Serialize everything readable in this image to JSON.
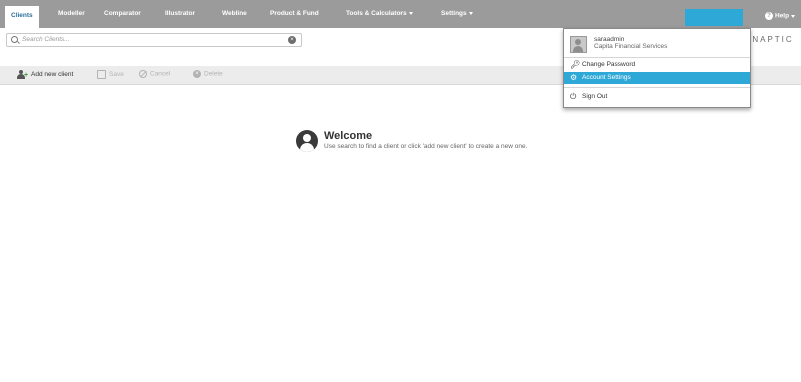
{
  "nav": {
    "tabs": [
      {
        "label": "Clients"
      },
      {
        "label": "Modeller"
      },
      {
        "label": "Comparator"
      },
      {
        "label": "Illustrator"
      },
      {
        "label": "Webline"
      },
      {
        "label": "Product & Fund"
      },
      {
        "label": "Tools & Calculators"
      },
      {
        "label": "Settings"
      }
    ],
    "help_label": "Help"
  },
  "search": {
    "placeholder": "Search Clients..."
  },
  "brand": "YNAPTIC",
  "toolbar": {
    "add_label": "Add new client",
    "save_label": "Save",
    "cancel_label": "Cancel",
    "delete_label": "Delete"
  },
  "welcome": {
    "title": "Welcome",
    "message": "Use search to find a client or click 'add new client' to create a new one."
  },
  "user_menu": {
    "username": "saraadmin",
    "organisation": "Capita Financial Services",
    "items": [
      {
        "label": "Change Password",
        "icon": "key-icon"
      },
      {
        "label": "Account Settings",
        "icon": "gear-icon"
      },
      {
        "label": "Sign Out",
        "icon": "power-icon"
      }
    ]
  },
  "colors": {
    "nav_bg": "#9b9b9b",
    "accent": "#2ea8d6",
    "active_tab_text": "#2b6f9a"
  }
}
